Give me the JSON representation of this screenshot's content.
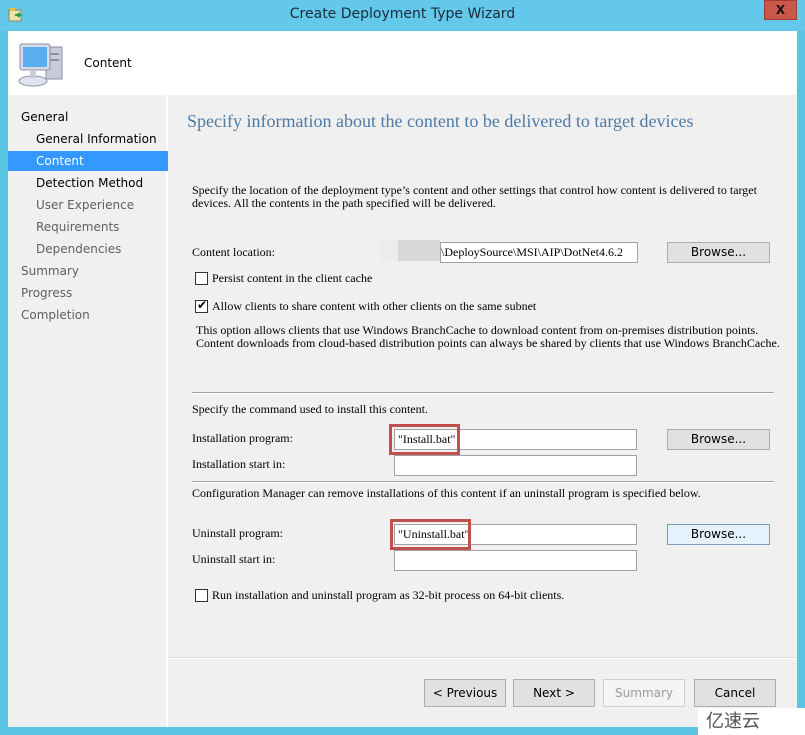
{
  "window": {
    "title": "Create Deployment Type Wizard",
    "close_label": "X"
  },
  "header": {
    "title": "Content",
    "icon": "computer-icon"
  },
  "sidebar": {
    "items": [
      {
        "label": "General",
        "level": 0,
        "state": "bold"
      },
      {
        "label": "General Information",
        "level": 1,
        "state": "bold"
      },
      {
        "label": "Content",
        "level": 1,
        "state": "active"
      },
      {
        "label": "Detection Method",
        "level": 1,
        "state": "bold"
      },
      {
        "label": "User Experience",
        "level": 1,
        "state": "dim"
      },
      {
        "label": "Requirements",
        "level": 1,
        "state": "dim"
      },
      {
        "label": "Dependencies",
        "level": 1,
        "state": "dim"
      },
      {
        "label": "Summary",
        "level": 0,
        "state": "dim"
      },
      {
        "label": "Progress",
        "level": 0,
        "state": "dim"
      },
      {
        "label": "Completion",
        "level": 0,
        "state": "dim"
      }
    ]
  },
  "main": {
    "heading": "Specify information about the content to be delivered to target devices",
    "description": "Specify the location of the deployment type’s content and other settings that control how content is delivered to target devices. All the contents in the path specified will be delivered.",
    "content_location": {
      "label": "Content location:",
      "value": "\\DeploySource\\MSI\\AIP\\DotNet4.6.2",
      "browse_label": "Browse..."
    },
    "persist_cache": {
      "label": "Persist content in the client cache",
      "checked": false
    },
    "allow_share": {
      "label": "Allow clients to share content with other clients on the same subnet",
      "checked": true
    },
    "branchcache_note_1": "This option allows clients that use Windows BranchCache to download content from on-premises distribution points.",
    "branchcache_note_2": "Content downloads from cloud-based distribution points can always be shared by clients that use Windows BranchCache.",
    "install_section_label": "Specify the command used to install this content.",
    "installation_program": {
      "label": "Installation program:",
      "value": "\"Install.bat\"",
      "browse_label": "Browse..."
    },
    "installation_start_in": {
      "label": "Installation start in:",
      "value": ""
    },
    "uninstall_section_label": "Configuration Manager can remove installations of this content if an uninstall program is specified below.",
    "uninstall_program": {
      "label": "Uninstall program:",
      "value": "\"Uninstall.bat\"",
      "browse_label": "Browse..."
    },
    "uninstall_start_in": {
      "label": "Uninstall start in:",
      "value": ""
    },
    "run_32bit": {
      "label": "Run installation and uninstall program as 32-bit process on 64-bit clients.",
      "checked": false
    }
  },
  "footer": {
    "previous_label": "< Previous",
    "next_label": "Next >",
    "summary_label": "Summary",
    "cancel_label": "Cancel"
  },
  "watermark": "亿速云",
  "colors": {
    "titlebar": "#63c8e9",
    "heading": "#4e7aa6",
    "nav_active": "#3399ff",
    "highlight_box": "#c0504d",
    "close_button": "#c9574a"
  }
}
